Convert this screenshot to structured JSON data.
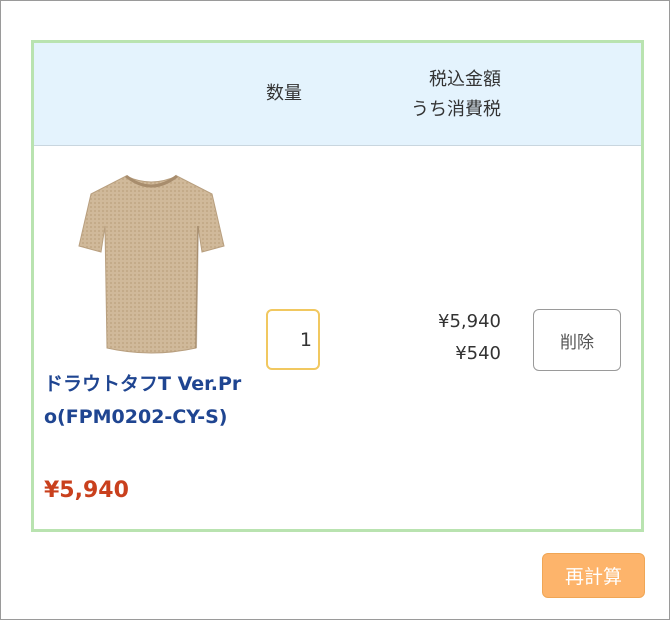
{
  "cart": {
    "header": {
      "quantity_label": "数量",
      "price_label_line1": "税込金額",
      "price_label_line2": "うち消費税"
    },
    "items": [
      {
        "name": "ドラウトタフT Ver.Pro(FPM0202-CY-S)",
        "price": "¥5,940",
        "quantity": "1",
        "total": "¥5,940",
        "tax": "¥540",
        "delete_label": "削除",
        "image_icon": "tshirt-product-image"
      }
    ]
  },
  "actions": {
    "recalculate_label": "再計算"
  },
  "colors": {
    "header_bg": "#e4f3fd",
    "cart_border": "#b9e3b0",
    "product_name": "#1f4591",
    "product_price": "#c9401d",
    "qty_border": "#f1c860",
    "recalc_bg": "#fdb46b"
  }
}
